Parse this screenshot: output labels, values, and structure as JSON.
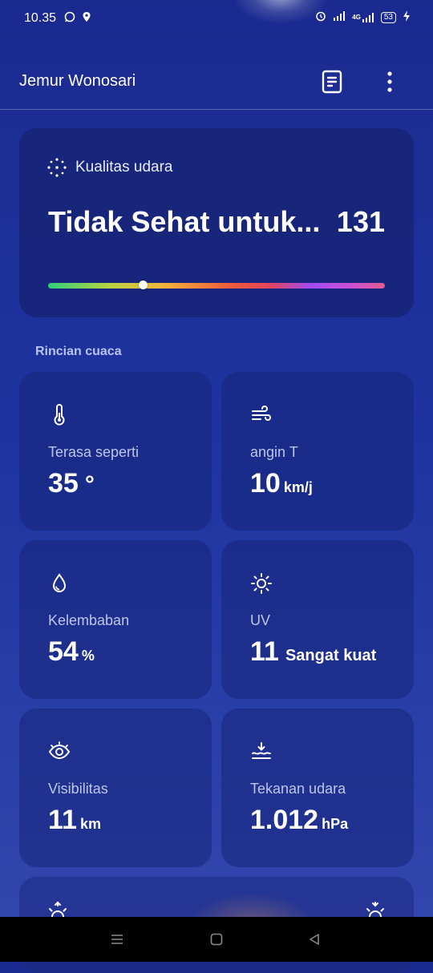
{
  "status_bar": {
    "time": "10.35",
    "left_icons": [
      "whatsapp-icon",
      "location-pin-icon"
    ],
    "right_icons": [
      "alarm-icon",
      "signal-icon",
      "4g-signal-icon",
      "charging-icon"
    ],
    "network_label": "4G",
    "battery_level": "53"
  },
  "app_bar": {
    "title": "Jemur Wonosari",
    "actions": [
      "document-icon",
      "more-vert-icon"
    ]
  },
  "air_quality": {
    "label": "Kualitas udara",
    "status": "Tidak Sehat untuk...",
    "value": "131",
    "scale_position_fraction": 0.28,
    "gradient_colors": [
      "#2fd07a",
      "#b6d440",
      "#f2b43a",
      "#ee5c3c",
      "#a24cf3",
      "#e35d8e"
    ]
  },
  "details": {
    "section_title": "Rincian cuaca",
    "tiles": [
      {
        "icon": "thermometer-icon",
        "label": "Terasa seperti",
        "value": "35",
        "unit": "°"
      },
      {
        "icon": "wind-icon",
        "label": "angin T",
        "value": "10",
        "unit": "km/j"
      },
      {
        "icon": "humidity-drop-icon",
        "label": "Kelembaban",
        "value": "54",
        "unit": "%"
      },
      {
        "icon": "sun-icon",
        "label": "UV",
        "value": "11",
        "unit": "Sangat kuat"
      },
      {
        "icon": "eye-icon",
        "label": "Visibilitas",
        "value": "11",
        "unit": "km"
      },
      {
        "icon": "pressure-icon",
        "label": "Tekanan udara",
        "value": "1.012",
        "unit": "hPa"
      }
    ]
  },
  "nav_bar": {
    "buttons": [
      "menu-icon",
      "home-icon",
      "back-icon"
    ]
  },
  "colors": {
    "background_top": "#1b2a8f",
    "background_bottom": "#3447ae",
    "card": "#16247a",
    "label_text": "#bcc6ea"
  }
}
